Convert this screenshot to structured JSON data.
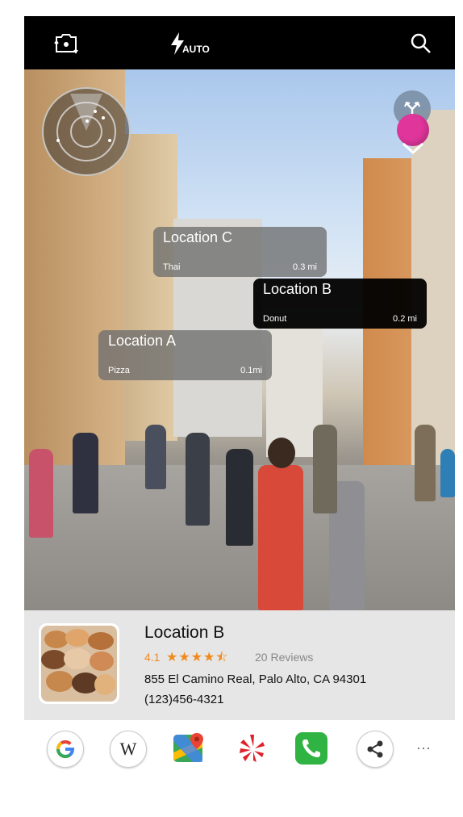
{
  "topbar": {
    "flip_camera_icon": "camera-flip-icon",
    "flash_icon": "flash-icon",
    "flash_mode": "AUTO",
    "search_icon": "search-icon"
  },
  "ar_labels": [
    {
      "name": "Location C",
      "category": "Thai",
      "distance": "0.3 mi"
    },
    {
      "name": "Location B",
      "category": "Donut",
      "distance": "0.2 mi"
    },
    {
      "name": "Location A",
      "category": "Pizza",
      "distance": "0.1mi"
    }
  ],
  "detail": {
    "name": "Location B",
    "rating": "4.1",
    "stars": "★★★★⯪",
    "reviews": "20 Reviews",
    "address": "855 El Camino Real, Palo Alto, CA 94301",
    "phone": "(123)456-4321"
  },
  "apps": {
    "google": "G",
    "wikipedia": "W",
    "maps": "maps-icon",
    "yelp": "yelp-icon",
    "phone": "phone-icon",
    "share": "share-icon",
    "more": "···"
  },
  "colors": {
    "accent_pink": "#e0359b",
    "star_orange": "#f08a1c",
    "label_dark": "#000000",
    "label_gray": "#6e6e6e"
  }
}
